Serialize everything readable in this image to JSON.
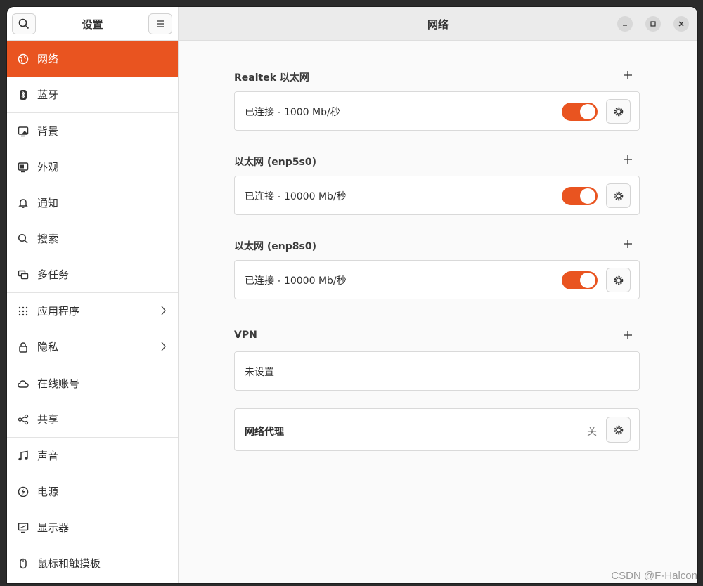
{
  "sidebar": {
    "title": "设置",
    "search_icon": "search-icon",
    "menu_icon": "hamburger-menu-icon",
    "items": [
      {
        "label": "网络",
        "icon": "globe-icon"
      },
      {
        "label": "蓝牙",
        "icon": "bluetooth-icon"
      },
      {
        "label": "背景",
        "icon": "monitor-background-icon"
      },
      {
        "label": "外观",
        "icon": "appearance-icon"
      },
      {
        "label": "通知",
        "icon": "bell-icon"
      },
      {
        "label": "搜索",
        "icon": "search-icon"
      },
      {
        "label": "多任务",
        "icon": "multitasking-icon"
      },
      {
        "label": "应用程序",
        "icon": "apps-grid-icon"
      },
      {
        "label": "隐私",
        "icon": "lock-icon"
      },
      {
        "label": "在线账号",
        "icon": "cloud-icon"
      },
      {
        "label": "共享",
        "icon": "share-icon"
      },
      {
        "label": "声音",
        "icon": "music-note-icon"
      },
      {
        "label": "电源",
        "icon": "power-icon"
      },
      {
        "label": "显示器",
        "icon": "display-icon"
      },
      {
        "label": "鼠标和触摸板",
        "icon": "mouse-icon"
      }
    ]
  },
  "header": {
    "title": "网络"
  },
  "sections": [
    {
      "title": "Realtek 以太网",
      "status": "已连接 - 1000 Mb/秒",
      "toggle_on": true
    },
    {
      "title": "以太网 (enp5s0)",
      "status": "已连接 - 10000 Mb/秒",
      "toggle_on": true
    },
    {
      "title": "以太网 (enp8s0)",
      "status": "已连接 - 10000 Mb/秒",
      "toggle_on": true
    }
  ],
  "vpn": {
    "title": "VPN",
    "status": "未设置"
  },
  "proxy": {
    "label": "网络代理",
    "state": "关"
  },
  "colors": {
    "accent": "#e95420"
  },
  "watermark": "CSDN @F-Halcon"
}
